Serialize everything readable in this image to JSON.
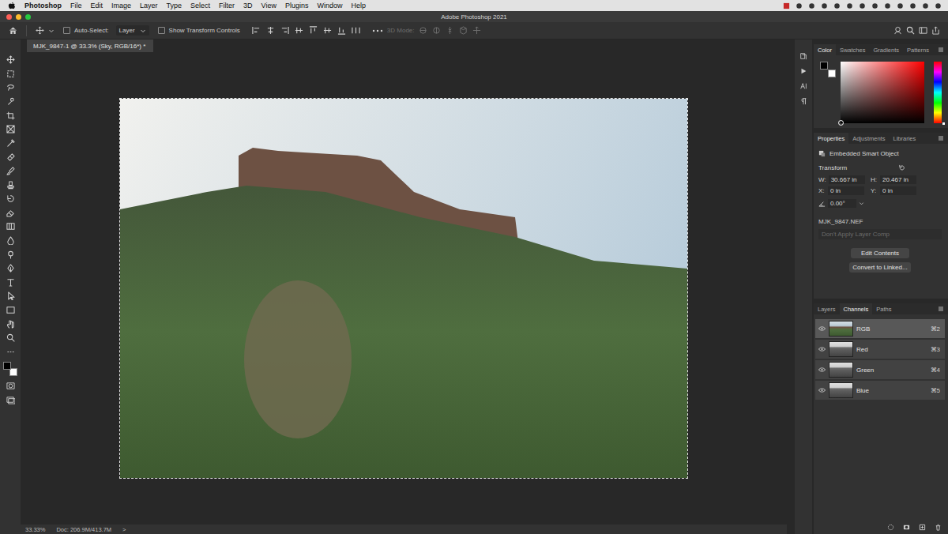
{
  "menubar": {
    "app": "Photoshop",
    "items": [
      "File",
      "Edit",
      "Image",
      "Layer",
      "Type",
      "Select",
      "Filter",
      "3D",
      "View",
      "Plugins",
      "Window",
      "Help"
    ]
  },
  "window": {
    "title": "Adobe Photoshop 2021"
  },
  "options_bar": {
    "auto_select": {
      "label": "Auto-Select:",
      "checked": false
    },
    "target": "Layer",
    "show_transform": {
      "label": "Show Transform Controls",
      "checked": false
    },
    "mode_label": "3D Mode:",
    "mode_disabled": true
  },
  "document": {
    "tab": "MJK_9847-1 @ 33.3% (Sky, RGB/16*) *"
  },
  "status_bar": {
    "zoom": "33.33%",
    "doc": "Doc: 206.9M/413.7M",
    "arrow": ">"
  },
  "color_panel": {
    "tabs": [
      {
        "label": "Color",
        "selected": true
      },
      {
        "label": "Swatches",
        "selected": false
      },
      {
        "label": "Gradients",
        "selected": false
      },
      {
        "label": "Patterns",
        "selected": false
      }
    ]
  },
  "properties_panel": {
    "tabs": [
      {
        "label": "Properties",
        "selected": true
      },
      {
        "label": "Adjustments",
        "selected": false
      },
      {
        "label": "Libraries",
        "selected": false
      }
    ],
    "kind": "Embedded Smart Object",
    "section": "Transform",
    "fields": [
      {
        "label": "W:",
        "value": "30.667 in"
      },
      {
        "label": "H:",
        "value": "20.467 in"
      },
      {
        "label": "X:",
        "value": "0 in"
      },
      {
        "label": "Y:",
        "value": "0 in"
      }
    ],
    "angle": "0.00°",
    "source": "MJK_9847.NEF",
    "layer_comp": {
      "label": "Don't Apply Layer Comp",
      "disabled": true
    },
    "buttons": [
      "Edit Contents",
      "Convert to Linked..."
    ]
  },
  "channels_panel": {
    "tabs": [
      {
        "label": "Layers",
        "selected": false
      },
      {
        "label": "Channels",
        "selected": true
      },
      {
        "label": "Paths",
        "selected": false
      }
    ],
    "channels": [
      {
        "name": "RGB",
        "shortcut": "⌘2",
        "visible": true,
        "selected": true,
        "kind": "composite"
      },
      {
        "name": "Red",
        "shortcut": "⌘3",
        "visible": true,
        "selected": false,
        "kind": "single"
      },
      {
        "name": "Green",
        "shortcut": "⌘4",
        "visible": true,
        "selected": false,
        "kind": "single"
      },
      {
        "name": "Blue",
        "shortcut": "⌘5",
        "visible": true,
        "selected": false,
        "kind": "single"
      }
    ]
  }
}
